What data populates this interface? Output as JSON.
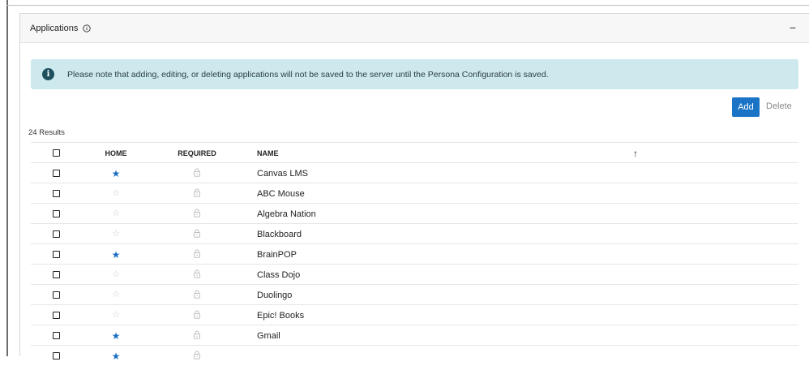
{
  "panel": {
    "title": "Applications",
    "collapse_label": "−"
  },
  "notice": {
    "icon": "i",
    "text": "Please note that adding, editing, or deleting applications will not be saved to the server until the Persona Configuration is saved."
  },
  "toolbar": {
    "add_label": "Add",
    "delete_label": "Delete"
  },
  "results_label": "24 Results",
  "table": {
    "headers": {
      "home": "HOME",
      "required": "REQUIRED",
      "name": "NAME",
      "sort": "↑"
    },
    "rows": [
      {
        "name": "Canvas LMS",
        "home": true
      },
      {
        "name": "ABC Mouse",
        "home": false
      },
      {
        "name": "Algebra Nation",
        "home": false
      },
      {
        "name": "Blackboard",
        "home": false
      },
      {
        "name": "BrainPOP",
        "home": true
      },
      {
        "name": "Class Dojo",
        "home": false
      },
      {
        "name": "Duolingo",
        "home": false
      },
      {
        "name": "Epic! Books",
        "home": false
      },
      {
        "name": "Gmail",
        "home": true
      },
      {
        "name": "",
        "home": true
      }
    ]
  },
  "icons": {
    "home_on": "★",
    "home_off": "☆",
    "required": "lock-icon",
    "info": "info-circle-icon"
  },
  "colors": {
    "accent": "#1a73c5",
    "notice_bg": "#cde9ee",
    "star_on": "#1a6fc2"
  }
}
